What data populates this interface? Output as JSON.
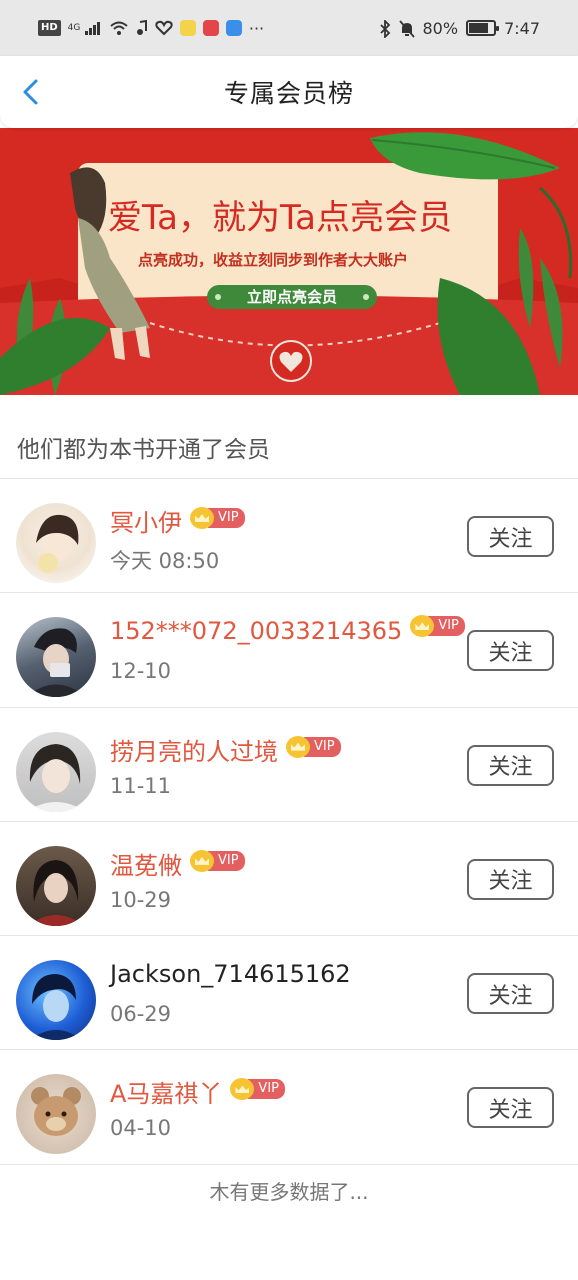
{
  "status_bar": {
    "network": "HD",
    "signal": "4G",
    "battery": "80%",
    "battery_level": 0.8,
    "time": "7:47",
    "more": "···"
  },
  "header": {
    "back_icon": "chevron-left-icon",
    "title": "专属会员榜"
  },
  "banner": {
    "headline": "爱Ta，就为Ta点亮会员",
    "subline": "点亮成功，收益立刻同步到作者大大账户",
    "cta": "立即点亮会员"
  },
  "section_title": "他们都为本书开通了会员",
  "members": [
    {
      "name": "冥小伊",
      "date": "今天 08:50",
      "vip": true,
      "vip_label": "VIP",
      "follow": "关注"
    },
    {
      "name": "152***072_0033214365",
      "date": "12-10",
      "vip": true,
      "vip_label": "VIP",
      "follow": "关注"
    },
    {
      "name": "捞月亮的人过境",
      "date": "11-11",
      "vip": true,
      "vip_label": "VIP",
      "follow": "关注"
    },
    {
      "name": "温莬敒",
      "date": "10-29",
      "vip": true,
      "vip_label": "VIP",
      "follow": "关注"
    },
    {
      "name": "Jackson_714615162",
      "date": "06-29",
      "vip": false,
      "vip_label": "",
      "follow": "关注"
    },
    {
      "name": "A马嘉祺丫",
      "date": "04-10",
      "vip": true,
      "vip_label": "VIP",
      "follow": "关注"
    }
  ],
  "footer": "木有更多数据了...",
  "colors": {
    "accent_blue": "#2a8de0",
    "vip_name": "#e0583f",
    "banner_red": "#d42a22",
    "banner_cream": "#fbe5c8",
    "cta_green": "#3f8a3a"
  }
}
